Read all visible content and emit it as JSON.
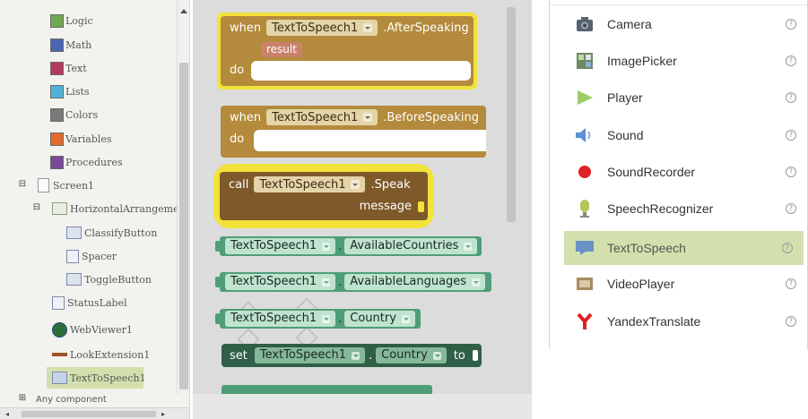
{
  "tree": {
    "builtins": [
      {
        "label": "Logic",
        "color": "#6fa84f"
      },
      {
        "label": "Math",
        "color": "#4a66b5"
      },
      {
        "label": "Text",
        "color": "#b53a5e"
      },
      {
        "label": "Lists",
        "color": "#4fb3d9"
      },
      {
        "label": "Colors",
        "color": "#7a7a7a"
      },
      {
        "label": "Variables",
        "color": "#e26a2c"
      },
      {
        "label": "Procedures",
        "color": "#7a4a9a"
      }
    ],
    "screen": "Screen1",
    "arrangement": "HorizontalArrangemer",
    "children": [
      "ClassifyButton",
      "Spacer",
      "ToggleButton"
    ],
    "components": [
      "StatusLabel",
      "WebViewer1",
      "LookExtension1",
      "TextToSpeech1"
    ],
    "any_component": "Any component",
    "collapse_symbol": "⊟",
    "expand_symbol": "⊞",
    "scroll_left": "◂",
    "scroll_right": "▸"
  },
  "blocks": {
    "after": {
      "when": "when",
      "component": "TextToSpeech1",
      "event": ".AfterSpeaking",
      "param": "result",
      "do": "do"
    },
    "before": {
      "when": "when",
      "component": "TextToSpeech1",
      "event": ".BeforeSpeaking",
      "do": "do"
    },
    "speak": {
      "call": "call",
      "component": "TextToSpeech1",
      "method": ".Speak",
      "arg": "message"
    },
    "getters": [
      {
        "component": "TextToSpeech1",
        "property": "AvailableCountries"
      },
      {
        "component": "TextToSpeech1",
        "property": "AvailableLanguages"
      },
      {
        "component": "TextToSpeech1",
        "property": "Country"
      }
    ],
    "setter": {
      "set": "set",
      "component": "TextToSpeech1",
      "property": "Country",
      "to": "to"
    },
    "dot": "."
  },
  "palette": {
    "items": [
      {
        "label": "Camera",
        "icon": "camera-icon"
      },
      {
        "label": "ImagePicker",
        "icon": "image-picker-icon"
      },
      {
        "label": "Player",
        "icon": "player-icon"
      },
      {
        "label": "Sound",
        "icon": "sound-icon"
      },
      {
        "label": "SoundRecorder",
        "icon": "sound-recorder-icon"
      },
      {
        "label": "SpeechRecognizer",
        "icon": "speech-recognizer-icon"
      },
      {
        "label": "TextToSpeech",
        "icon": "text-to-speech-icon",
        "selected": true
      },
      {
        "label": "VideoPlayer",
        "icon": "video-player-icon"
      },
      {
        "label": "YandexTranslate",
        "icon": "yandex-translate-icon"
      }
    ],
    "help_symbol": "?"
  },
  "colors": {
    "event_block": "#b48a3c",
    "call_block": "#7e5a2a",
    "getter_block": "#4f9e79",
    "setter_block": "#2f5f46",
    "highlight": "#f2e33a",
    "palette_selected": "#d3e0ae"
  }
}
